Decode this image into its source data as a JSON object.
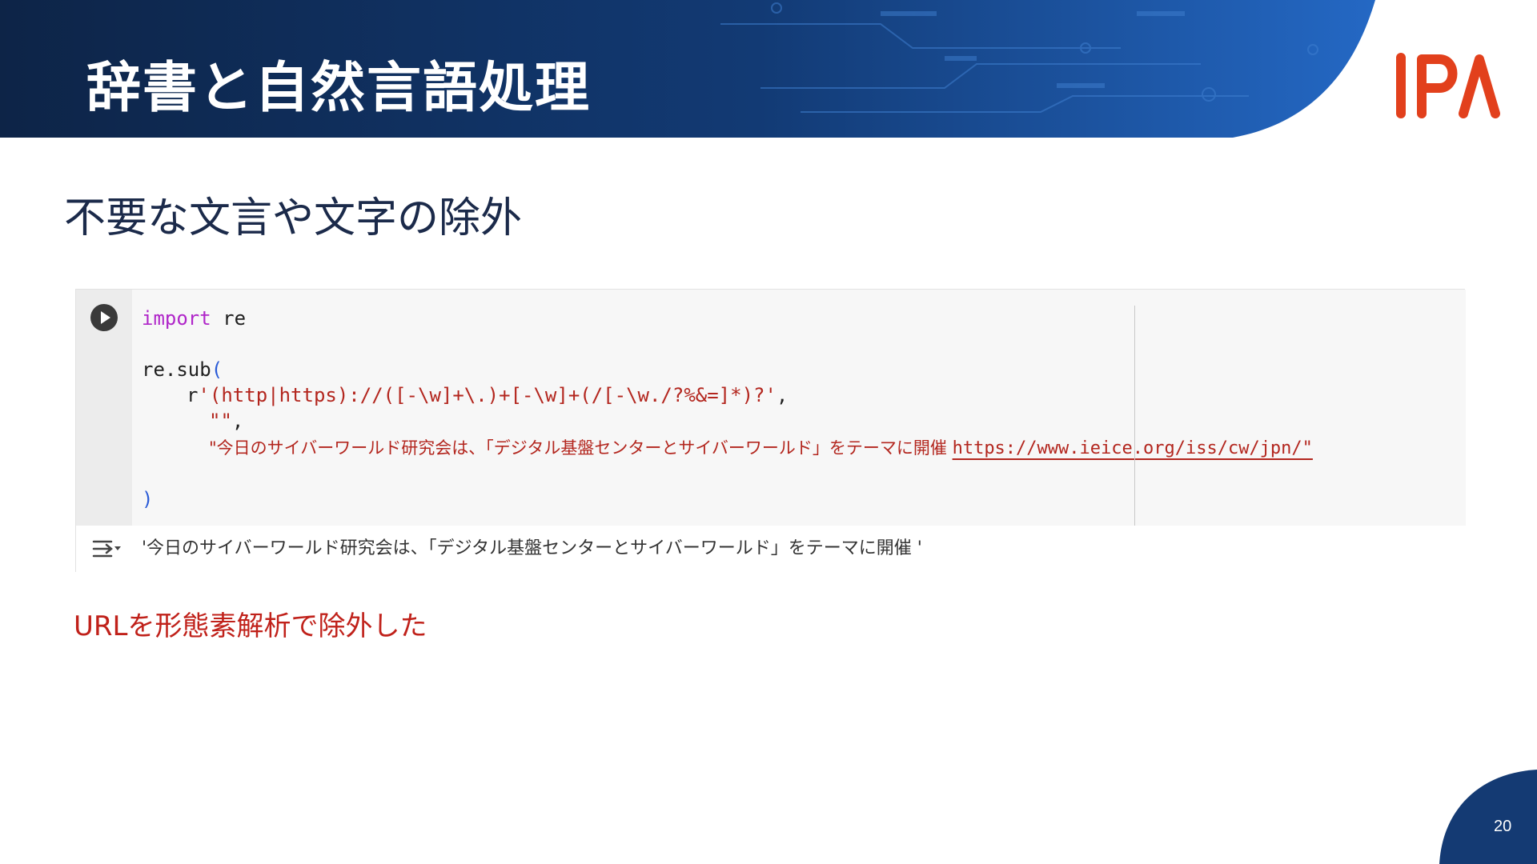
{
  "slide": {
    "title": "辞書と自然言語処理",
    "subtitle": "不要な文言や文字の除外",
    "logo_text": "IPA",
    "note": "URLを形態素解析で除外した",
    "page_number": "20"
  },
  "colors": {
    "banner_dark": "#0d2a54",
    "banner_light": "#1f5aa8",
    "logo": "#e2401c",
    "note": "#c0211a"
  },
  "code_cell": {
    "run_icon": "play-circle-icon",
    "lines": {
      "l1_keyword": "import",
      "l1_rest": " re",
      "l2_func": "re.sub",
      "l2_paren": "(",
      "l3_prefix": "r",
      "l3_pattern": "'(http|https)://([-\\w]+\\.)+[-\\w]+(/[-\\w./?%&=]*)?'",
      "l3_comma": ",",
      "l4_string": "\"\"",
      "l4_comma": ",",
      "l5_string": "\"今日のサイバーワールド研究会は、「デジタル基盤センターとサイバーワールド」をテーマに開催 ",
      "l5_url": "https://www.ieice.org/iss/cw/jpn/\"",
      "l6_paren": ")"
    },
    "output_icon": "output-toggle-icon",
    "output_text": "'今日のサイバーワールド研究会は、「デジタル基盤センターとサイバーワールド」をテーマに開催 '"
  }
}
